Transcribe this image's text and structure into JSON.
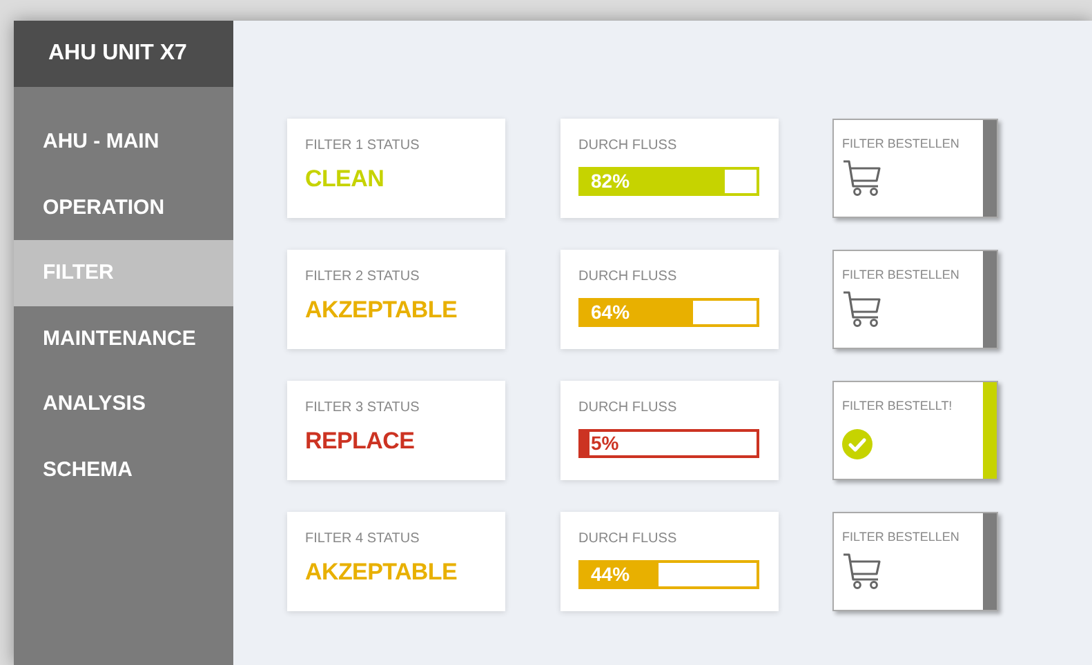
{
  "sidebar": {
    "title": "AHU UNIT X7",
    "items": [
      {
        "label": "AHU - MAIN",
        "selected": false
      },
      {
        "label": "OPERATION",
        "selected": false
      },
      {
        "label": "FILTER",
        "selected": true
      },
      {
        "label": "MAINTENANCE",
        "selected": false
      },
      {
        "label": "ANALYSIS",
        "selected": false
      },
      {
        "label": "SCHEMA",
        "selected": false
      }
    ]
  },
  "filters": [
    {
      "status_label": "FILTER 1 STATUS",
      "status": "CLEAN",
      "color": "#c6d300",
      "flow_label": "DURCH FLUSS",
      "level": 0.82,
      "reading": "82%",
      "order_label": "FILTER BESTELLEN",
      "ordered": false
    },
    {
      "status_label": "FILTER 2 STATUS",
      "status": "AKZEPTABLE",
      "color": "#e8b000",
      "flow_label": "DURCH FLUSS",
      "level": 0.64,
      "reading": "64%",
      "order_label": "FILTER BESTELLEN",
      "ordered": false
    },
    {
      "status_label": "FILTER 3 STATUS",
      "status": "REPLACE",
      "color": "#cc3322",
      "flow_label": "DURCH FLUSS",
      "level": 0.05,
      "reading": "5%",
      "order_label": "FILTER BESTELLT!",
      "ordered": true
    },
    {
      "status_label": "FILTER 4 STATUS",
      "status": "AKZEPTABLE",
      "color": "#e8b000",
      "flow_label": "DURCH FLUSS",
      "level": 0.44,
      "reading": "44%",
      "order_label": "FILTER BESTELLEN",
      "ordered": false
    }
  ]
}
